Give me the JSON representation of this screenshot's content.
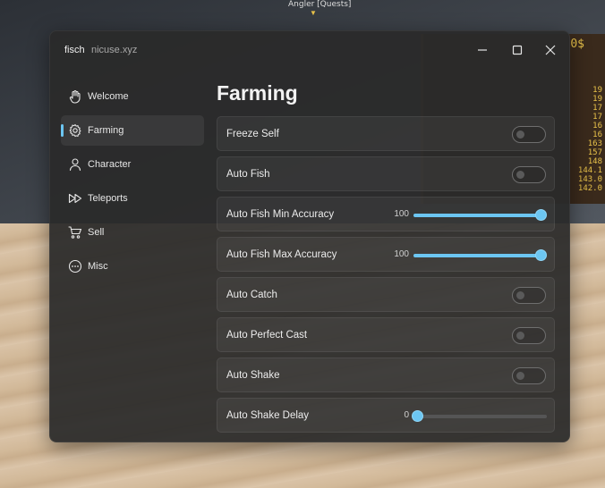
{
  "background": {
    "header_text": "Angler [Quests]",
    "board_lines": [
      "0$",
      "19",
      "19",
      "17",
      "17",
      "16",
      "16",
      "163",
      "157",
      "148",
      "144.1",
      "143.0",
      "142.0"
    ]
  },
  "window": {
    "title": "fisch",
    "subtitle": "nicuse.xyz",
    "controls": {
      "minimize_icon": "minimize-icon",
      "maximize_icon": "maximize-icon",
      "close_icon": "close-icon"
    }
  },
  "sidebar": {
    "active_index": 1,
    "accent_color": "#6cc6f2",
    "items": [
      {
        "label": "Welcome",
        "icon": "hand-wave-icon"
      },
      {
        "label": "Farming",
        "icon": "gear-icon"
      },
      {
        "label": "Character",
        "icon": "person-icon"
      },
      {
        "label": "Teleports",
        "icon": "fast-forward-icon"
      },
      {
        "label": "Sell",
        "icon": "cart-icon"
      },
      {
        "label": "Misc",
        "icon": "more-circle-icon"
      }
    ]
  },
  "page": {
    "title": "Farming",
    "rows": [
      {
        "label": "Freeze Self",
        "type": "toggle",
        "on": false
      },
      {
        "label": "Auto Fish",
        "type": "toggle",
        "on": false
      },
      {
        "label": "Auto Fish Min Accuracy",
        "type": "slider",
        "value": "100",
        "fraction": 1.0
      },
      {
        "label": "Auto Fish Max Accuracy",
        "type": "slider",
        "value": "100",
        "fraction": 1.0
      },
      {
        "label": "Auto Catch",
        "type": "toggle",
        "on": false
      },
      {
        "label": "Auto Perfect Cast",
        "type": "toggle",
        "on": false
      },
      {
        "label": "Auto Shake",
        "type": "toggle",
        "on": false
      },
      {
        "label": "Auto Shake Delay",
        "type": "slider",
        "value": "0",
        "fraction": 0.0
      }
    ]
  }
}
